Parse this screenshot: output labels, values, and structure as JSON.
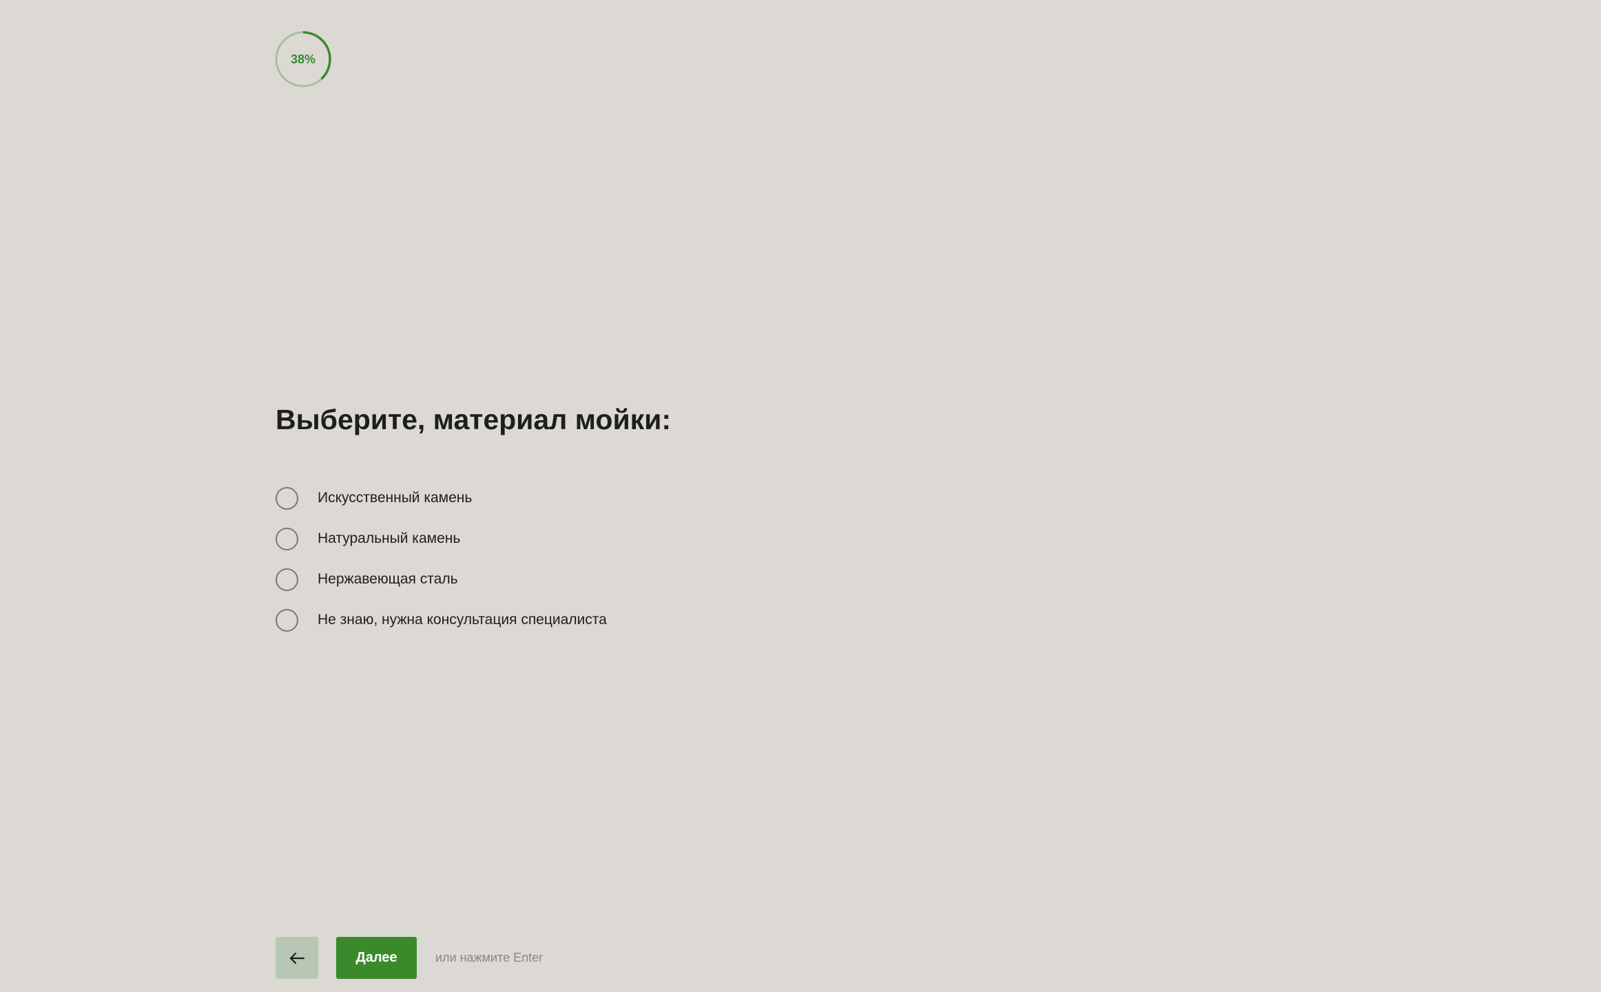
{
  "progress": {
    "percent": 38,
    "label": "38%",
    "color": "#3a8a2c",
    "track_color": "#a8bda0"
  },
  "question": {
    "title": "Выберите, материал мойки:",
    "options": [
      {
        "label": "Искусственный камень",
        "selected": false
      },
      {
        "label": "Натуральный камень",
        "selected": false
      },
      {
        "label": "Нержавеющая сталь",
        "selected": false
      },
      {
        "label": "Не знаю, нужна консультация специалиста",
        "selected": false
      }
    ]
  },
  "navigation": {
    "back_icon": "arrow-left-icon",
    "next_label": "Далее",
    "hint": "или нажмите Enter",
    "accent_color": "#3a8a2c",
    "back_button_color": "#b8c7b3"
  }
}
